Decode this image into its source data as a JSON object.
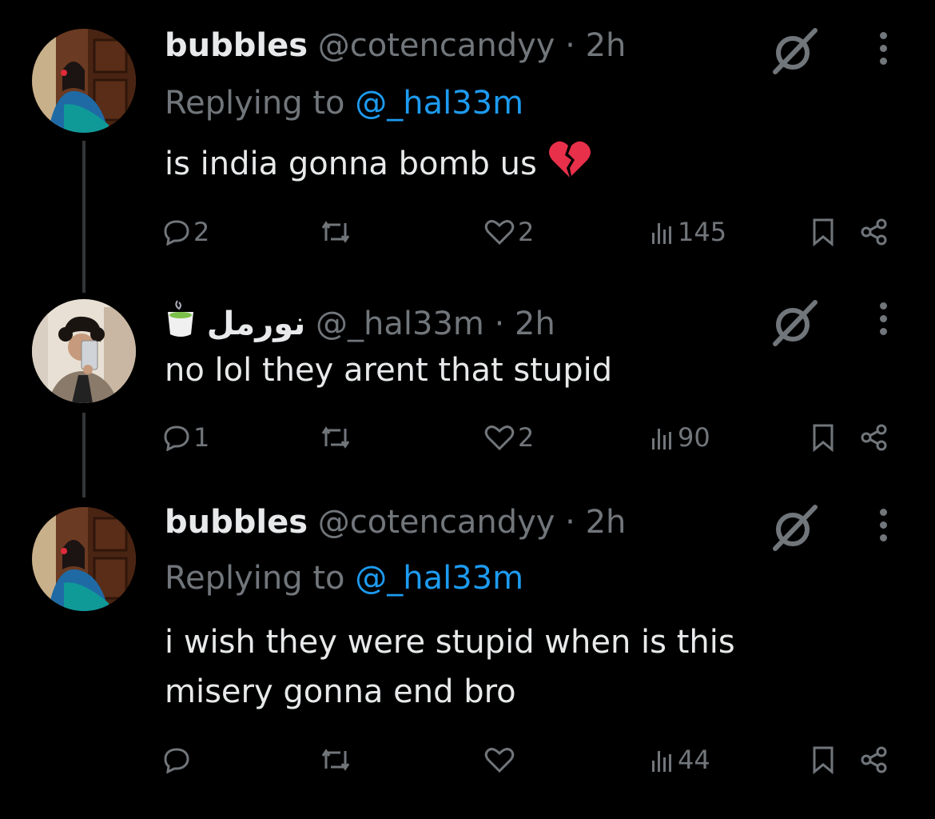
{
  "theme": {
    "background": "#000000",
    "text": "#e7e9ea",
    "muted": "#71767b",
    "accent": "#1d9bf0",
    "thread_line": "#333639"
  },
  "tweets": [
    {
      "name": "bubbles",
      "handle": "@cotencandyy",
      "time": "· 2h",
      "replying_prefix": "Replying to",
      "replying_to": "@_hal33m",
      "text": "is india gonna bomb us",
      "emoji_icon": "broken-heart-icon",
      "replies": "2",
      "reposts": "",
      "likes": "2",
      "views": "145"
    },
    {
      "name_emoji_icon": "matcha-tea-icon",
      "name": "نورمل",
      "handle": "@_hal33m",
      "time": "· 2h",
      "text": "no lol they arent that stupid",
      "replies": "1",
      "reposts": "",
      "likes": "2",
      "views": "90"
    },
    {
      "name": "bubbles",
      "handle": "@cotencandyy",
      "time": "· 2h",
      "replying_prefix": "Replying to",
      "replying_to": "@_hal33m",
      "text_line1": "i wish they were stupid when is this",
      "text_line2": "misery gonna end bro",
      "replies": "",
      "reposts": "",
      "likes": "",
      "views": "44"
    }
  ]
}
